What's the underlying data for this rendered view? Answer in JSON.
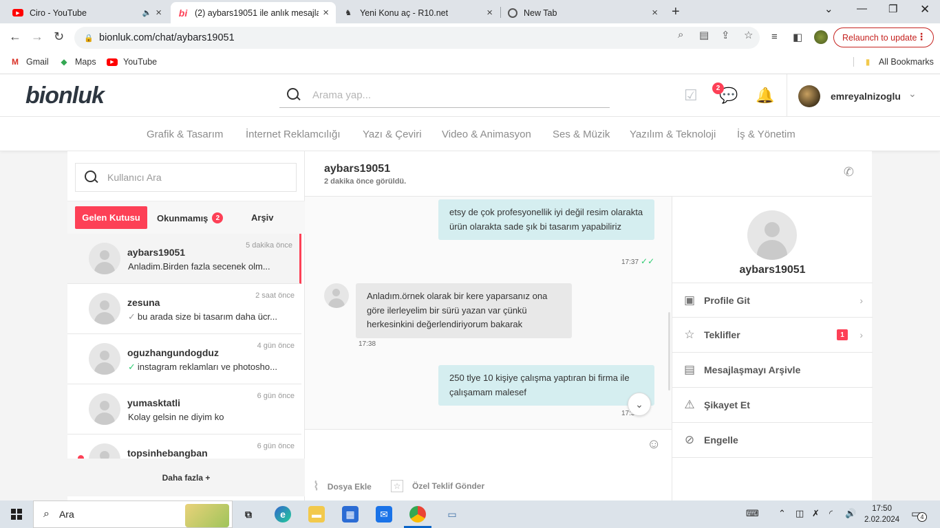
{
  "browser": {
    "tabs": [
      {
        "title": "Ciro - YouTube",
        "favicon": "youtube-icon"
      },
      {
        "title": "(2) aybars19051 ile anlık mesajlaş",
        "favicon": "bionluk-icon"
      },
      {
        "title": "Yeni Konu aç - R10.net",
        "favicon": "r10-icon"
      },
      {
        "title": "New Tab",
        "favicon": "chrome-icon"
      }
    ],
    "url": "bionluk.com/chat/aybars19051",
    "relaunch_label": "Relaunch to update",
    "bookmarks": [
      "Gmail",
      "Maps",
      "YouTube"
    ],
    "all_bookmarks": "All Bookmarks"
  },
  "site": {
    "logo": "bionluk",
    "search_placeholder": "Arama yap...",
    "messages_badge": "2",
    "username": "emreyalnizoglu",
    "categories": [
      "Grafik & Tasarım",
      "İnternet Reklamcılığı",
      "Yazı & Çeviri",
      "Video & Animasyon",
      "Ses & Müzik",
      "Yazılım & Teknoloji",
      "İş & Yönetim"
    ]
  },
  "inbox": {
    "search_placeholder": "Kullanıcı Ara",
    "tab_inbox": "Gelen Kutusu",
    "tab_unread": "Okunmamış",
    "unread_count": "2",
    "tab_archive": "Arşiv",
    "conversations": [
      {
        "name": "aybars19051",
        "time": "5 dakika önce",
        "preview": "Anladim.Birden fazla secenek olm..."
      },
      {
        "name": "zesuna",
        "time": "2 saat önce",
        "preview": "bu arada size bi tasarım daha ücr..."
      },
      {
        "name": "oguzhangundogduz",
        "time": "4 gün önce",
        "preview": "instagram reklamları ve photosho..."
      },
      {
        "name": "yumasktatli",
        "time": "6 gün önce",
        "preview": "Kolay gelsin ne diyim ko"
      },
      {
        "name": "topsinhebangban",
        "time": "6 gün önce",
        "preview": ""
      }
    ],
    "more_label": "Daha fazla +"
  },
  "chat": {
    "name": "aybars19051",
    "last_seen": "2 dakika önce görüldü.",
    "messages": [
      {
        "direction": "out",
        "text": "etsy de çok profesyonellik iyi değil resim olarakta ürün olarakta sade şık bi tasarım yapabiliriz",
        "time": "17:37"
      },
      {
        "direction": "in",
        "text": "Anladım.örnek olarak bir kere yaparsanız ona göre ilerleyelim bir sürü yazan var çünkü herkesinkini değerlendiriyorum bakarak",
        "time": "17:38"
      },
      {
        "direction": "out",
        "text": "250 tlye 10 kişiye çalışma yaptıran bi firma ile çalışamam malesef",
        "time": "17:3"
      }
    ],
    "attach_label": "Dosya Ekle",
    "offer_label": "Özel Teklif Gönder"
  },
  "profile": {
    "name": "aybars19051",
    "actions": [
      {
        "label": "Profile Git",
        "icon": "profile-card-icon"
      },
      {
        "label": "Teklifler",
        "icon": "star-box-icon",
        "count": "1"
      },
      {
        "label": "Mesajlaşmayı Arşivle",
        "icon": "archive-icon"
      },
      {
        "label": "Şikayet Et",
        "icon": "warning-icon"
      },
      {
        "label": "Engelle",
        "icon": "block-icon"
      }
    ]
  },
  "taskbar": {
    "search": "Ara",
    "time": "17:50",
    "date": "2.02.2024",
    "notifications": "4"
  },
  "colors": {
    "accent": "#fd4056",
    "bubble_out": "#d5eef0",
    "bubble_in": "#e8e8e8"
  }
}
